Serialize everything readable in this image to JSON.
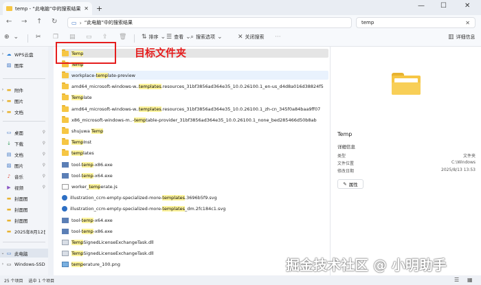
{
  "window": {
    "tab_title": "temp - “此电脑”中的搜索结果",
    "new_tab": "+",
    "minimize": "—",
    "maximize": "☐",
    "close": "✕"
  },
  "nav": {
    "address_segment": "“此电脑”中的搜索结果",
    "search_value": "temp"
  },
  "toolbar": {
    "new_label": "",
    "sort_label": "排序",
    "view_label": "查看",
    "search_options_label": "搜索选项",
    "close_search_label": "关闭搜索",
    "details_label": "详细信息"
  },
  "sidebar": [
    {
      "label": "WPS云盘",
      "icon": "☁",
      "chev": "›",
      "pin": ""
    },
    {
      "label": "图库",
      "icon": "▨",
      "chev": "",
      "pin": ""
    },
    {
      "label": "附件",
      "icon": "▬",
      "chev": "›",
      "pin": ""
    },
    {
      "label": "图片",
      "icon": "▬",
      "chev": "›",
      "pin": ""
    },
    {
      "label": "文档",
      "icon": "▬",
      "chev": "›",
      "pin": ""
    },
    {
      "label": "桌面",
      "icon": "▭",
      "chev": "",
      "pin": "⚲"
    },
    {
      "label": "下载",
      "icon": "↓",
      "chev": "",
      "pin": "⚲"
    },
    {
      "label": "文档",
      "icon": "▤",
      "chev": "",
      "pin": "⚲"
    },
    {
      "label": "图片",
      "icon": "▨",
      "chev": "",
      "pin": "⚲"
    },
    {
      "label": "音乐",
      "icon": "♪",
      "chev": "",
      "pin": "⚲"
    },
    {
      "label": "视频",
      "icon": "▶",
      "chev": "",
      "pin": "⚲"
    },
    {
      "label": "封面图",
      "icon": "▬",
      "chev": "",
      "pin": ""
    },
    {
      "label": "封面图",
      "icon": "▬",
      "chev": "",
      "pin": ""
    },
    {
      "label": "封面图",
      "icon": "▬",
      "chev": "",
      "pin": ""
    },
    {
      "label": "2025年8月12日",
      "icon": "▬",
      "chev": "",
      "pin": ""
    },
    {
      "label": "此电脑",
      "icon": "▭",
      "chev": "⌄",
      "pin": ""
    },
    {
      "label": "Windows-SSD",
      "icon": "▭",
      "chev": "›",
      "pin": ""
    }
  ],
  "files": [
    {
      "pre": "",
      "hl": "Temp",
      "post": "",
      "type": "folder"
    },
    {
      "pre": "",
      "hl": "Temp",
      "post": "",
      "type": "folder"
    },
    {
      "pre": "workplace-",
      "hl": "temp",
      "post": "late-preview",
      "type": "folder"
    },
    {
      "pre": "amd64_microsoft-windows-w..",
      "hl": "templates",
      "post": ".resources_31bf3856ad364e35_10.0.26100.1_en-us_d4d8a016d38824f5",
      "type": "folder"
    },
    {
      "pre": "",
      "hl": "Temp",
      "post": "late",
      "type": "folder"
    },
    {
      "pre": "amd64_microsoft-windows-w..",
      "hl": "templates",
      "post": ".resources_31bf3856ad364e35_10.0.26100.1_zh-cn_345f0a84baa9ff07",
      "type": "folder"
    },
    {
      "pre": "x86_microsoft-windows-m..-",
      "hl": "temp",
      "post": "table-provider_31bf3856ad364e35_10.0.26100.1_none_bed285466d50b8ab",
      "type": "folder"
    },
    {
      "pre": "shujuwa ",
      "hl": "Temp",
      "post": "",
      "type": "folder"
    },
    {
      "pre": "",
      "hl": "Temp",
      "post": "Inst",
      "type": "folder"
    },
    {
      "pre": "",
      "hl": "temp",
      "post": "lates",
      "type": "folder"
    },
    {
      "pre": "tool-",
      "hl": "temp",
      "post": "-x86.exe",
      "type": "exe"
    },
    {
      "pre": "tool-",
      "hl": "temp",
      "post": "-x64.exe",
      "type": "exe"
    },
    {
      "pre": "worker_",
      "hl": "temp",
      "post": "erate.js",
      "type": "js"
    },
    {
      "pre": "illustration_ccm-empty-specialized-more-",
      "hl": "templates",
      "post": ".3696b5f9.svg",
      "type": "svg"
    },
    {
      "pre": "illustration_ccm-empty-specialized-more-",
      "hl": "templates",
      "post": "_dm.2fc184c1.svg",
      "type": "svg"
    },
    {
      "pre": "tool-",
      "hl": "temp",
      "post": "-x64.exe",
      "type": "exe"
    },
    {
      "pre": "tool-",
      "hl": "temp",
      "post": "-x86.exe",
      "type": "exe"
    },
    {
      "pre": "",
      "hl": "Temp",
      "post": "SignedLicenseExchangeTask.dll",
      "type": "dll"
    },
    {
      "pre": "",
      "hl": "Temp",
      "post": "SignedLicenseExchangeTask.dll",
      "type": "dll"
    },
    {
      "pre": "",
      "hl": "temp",
      "post": "erature_100.png",
      "type": "png"
    }
  ],
  "annotation": {
    "text": "目标文件夹"
  },
  "details": {
    "title": "Temp",
    "subtitle": "详细信息",
    "type_key": "类型",
    "type_val": "文件夹",
    "location_key": "文件位置",
    "location_val": "C:\\Windows",
    "modified_key": "修改日期",
    "modified_val": "2025/8/13 13:53",
    "properties_label": "属性"
  },
  "status": {
    "count": "25 个项目",
    "selected": "选中 1 个项目"
  },
  "watermark": "掘金技术社区 @ 小明助手"
}
